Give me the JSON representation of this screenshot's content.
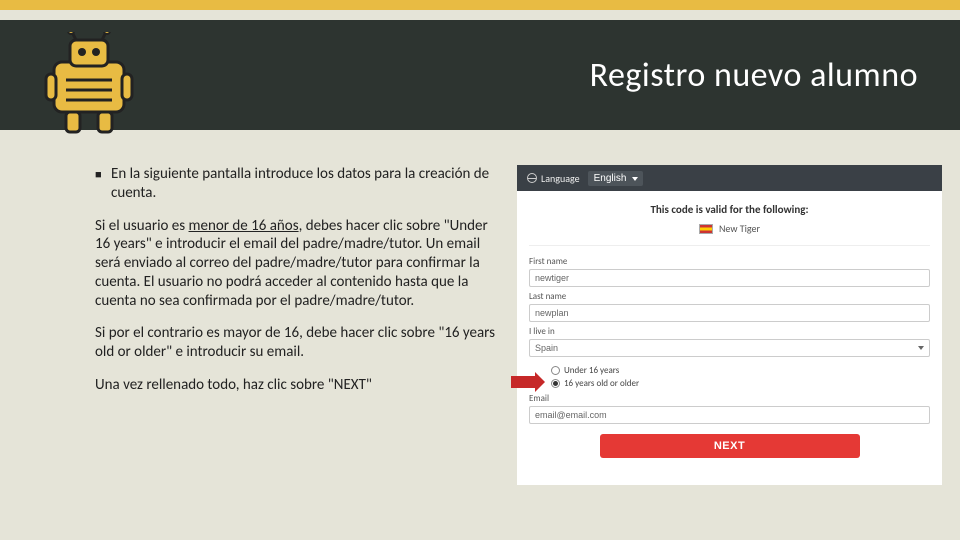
{
  "banner": {
    "title": "Registro nuevo alumno"
  },
  "text": {
    "bullet1": "En la siguiente pantalla introduce los datos para la creación de cuenta.",
    "p1_a": "Si el usuario es ",
    "p1_u": "menor de 16 años",
    "p1_b": ", debes hacer clic sobre \"Under 16 years\" e introducir el email del padre/madre/tutor. Un email será enviado al correo del padre/madre/tutor para confirmar la cuenta. El usuario no podrá acceder al contenido hasta que la cuenta no sea confirmada por el padre/madre/tutor.",
    "p2": "Si por el contrario es mayor de 16, debe hacer clic sobre \"16 years old or older\" e introducir su email.",
    "p3": "Una vez rellenado todo, haz clic sobre \"NEXT\""
  },
  "form": {
    "language_label": "Language",
    "language_value": "English",
    "valid_text": "This code is valid for the following:",
    "chip_text": "New Tiger",
    "first_name_label": "First name",
    "first_name_value": "newtiger",
    "last_name_label": "Last name",
    "last_name_value": "newplan",
    "live_in_label": "I live in",
    "live_in_value": "Spain",
    "radio_under": "Under 16 years",
    "radio_older": "16 years old or older",
    "email_label": "Email",
    "email_value": "email@email.com",
    "next_button": "NEXT"
  }
}
